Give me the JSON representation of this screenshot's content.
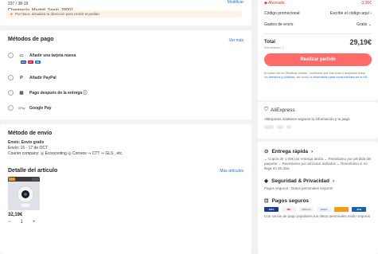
{
  "address": {
    "line1": "237 / 38-19",
    "line2": "Chapinería, Madrid, Spain, 28001",
    "modify": "Modificar",
    "warning": "Por favor, actualiza tu dirección para recibir el pedido"
  },
  "payment": {
    "title": "Métodos de pago",
    "see_more": "Ver más",
    "options": [
      {
        "label": "Añadir una tarjeta nueva",
        "icon": "credit-card-icon"
      },
      {
        "label": "Añadir PayPal",
        "icon": "paypal-icon"
      },
      {
        "label": "Pago después de la entrega ⓘ",
        "icon": "calendar-icon"
      },
      {
        "label": "Google Pay",
        "icon": "google-pay-icon"
      }
    ],
    "card_logos": [
      "VISA",
      "MC",
      "AE"
    ],
    "gpay_mark": "GPay"
  },
  "shipping": {
    "title": "Método de envío",
    "free": "Envío: Envío gratis",
    "dates": "Envío: 15 - 17 de OCT",
    "courier": "Courier company: ◎ Ecoscooting ◎ Correos ⇒ CTT ⇒ GLS , etc.",
    "detail_title": "Detalle del artículo",
    "more_articles": "Más artículos",
    "price": "32,19€",
    "qty": "1",
    "minus": "−",
    "plus": "+"
  },
  "summary": {
    "saved_label": "Ahorrado",
    "saved_value": "-3,00€",
    "promo_label": "Código promocional",
    "promo_value": "Escribe el código aquí",
    "ship_label": "Gastos de envío",
    "ship_value": "Gratis",
    "total_label": "Total",
    "total_value": "29,19€",
    "tax_note": "IVA incluido ⓘ",
    "cta": "Realizar pedido",
    "legal_1": "Al hacer clic en 'Realizar pedido', confirmas que has leído y aceptado todos los",
    "legal_link1": "términos y políticas",
    "legal_2": ", así como la",
    "legal_link2": "información para consumidores en la UE."
  },
  "secure": {
    "brand": "AliExpress",
    "text": "AliExpress mantiene seguros tu información y tu pago"
  },
  "features": {
    "fast_title": "Entrega rápida",
    "fast_text": "⌄ Cupón de 1,00€ por entrega tardía  ⌄ Reembolso por pérdida del paquete  ⌄ Reembolso por artículos dañados  ⌄ Reembolso si no llega en 35 días",
    "safety_title": "Seguridad & Privacidad",
    "safety_text": "Pagos seguros · Datos personales seguros",
    "pay_title": "Pagos seguros",
    "pay_text": "Con socios de pago populares tus datos personales están seguros",
    "pay_logos": [
      "VISA",
      "MC",
      "Dinners",
      "Sofort",
      "",
      "JCB"
    ]
  },
  "colors": {
    "accent": "#ff6b6b",
    "red": "#e4351f",
    "link": "#1a73e8"
  }
}
